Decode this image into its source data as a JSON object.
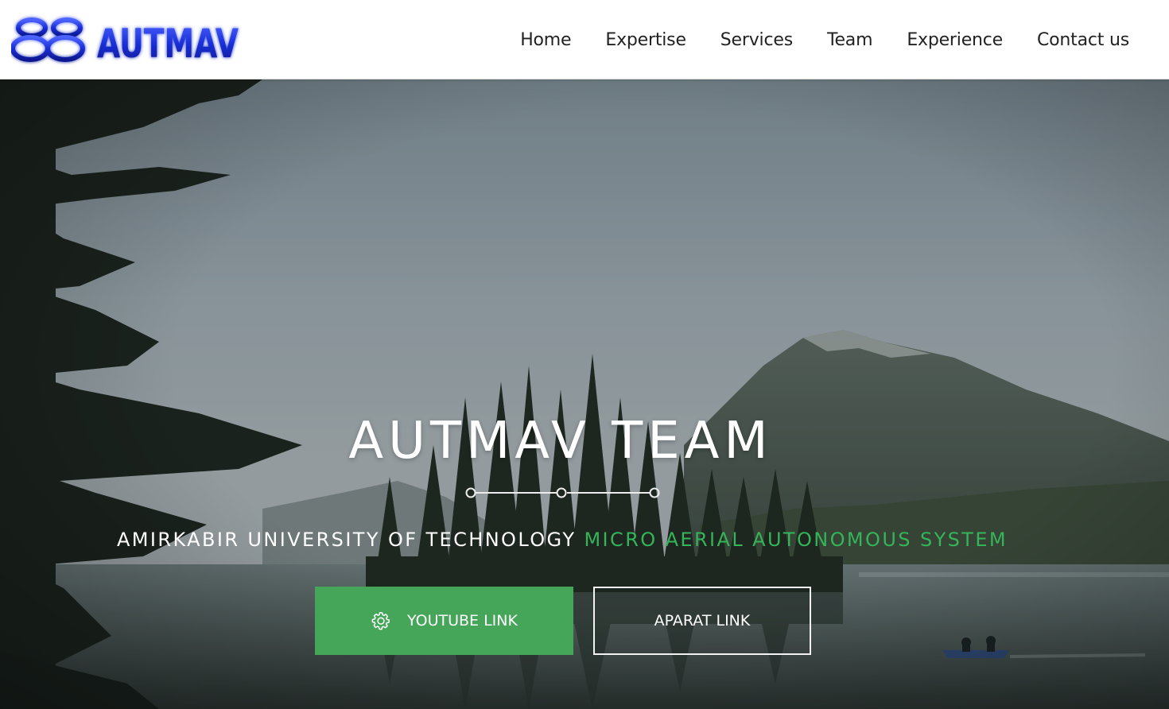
{
  "header": {
    "logo": {
      "mark": "88",
      "text": "AUTMAV",
      "colors": {
        "primary": "#1a2fd6",
        "glow": "#7ea6ff"
      }
    },
    "nav": [
      "Home",
      "Expertise",
      "Services",
      "Team",
      "Experience",
      "Contact us"
    ]
  },
  "hero": {
    "title": "AUTMAV TEAM",
    "subtitle_white": "AMIRKABIR UNIVERSITY OF TECHNOLOGY",
    "subtitle_green": "MICRO AERIAL AUTONOMOUS SYSTEM",
    "background": "mountain-lake-forest-photo",
    "buttons": {
      "youtube": {
        "label": "YOUTUBE LINK",
        "icon": "gear-icon"
      },
      "aparat": {
        "label": "APARAT LINK"
      }
    }
  },
  "colors": {
    "accent_green": "#35b459",
    "button_green": "#45a65a",
    "nav_text": "#222222"
  }
}
